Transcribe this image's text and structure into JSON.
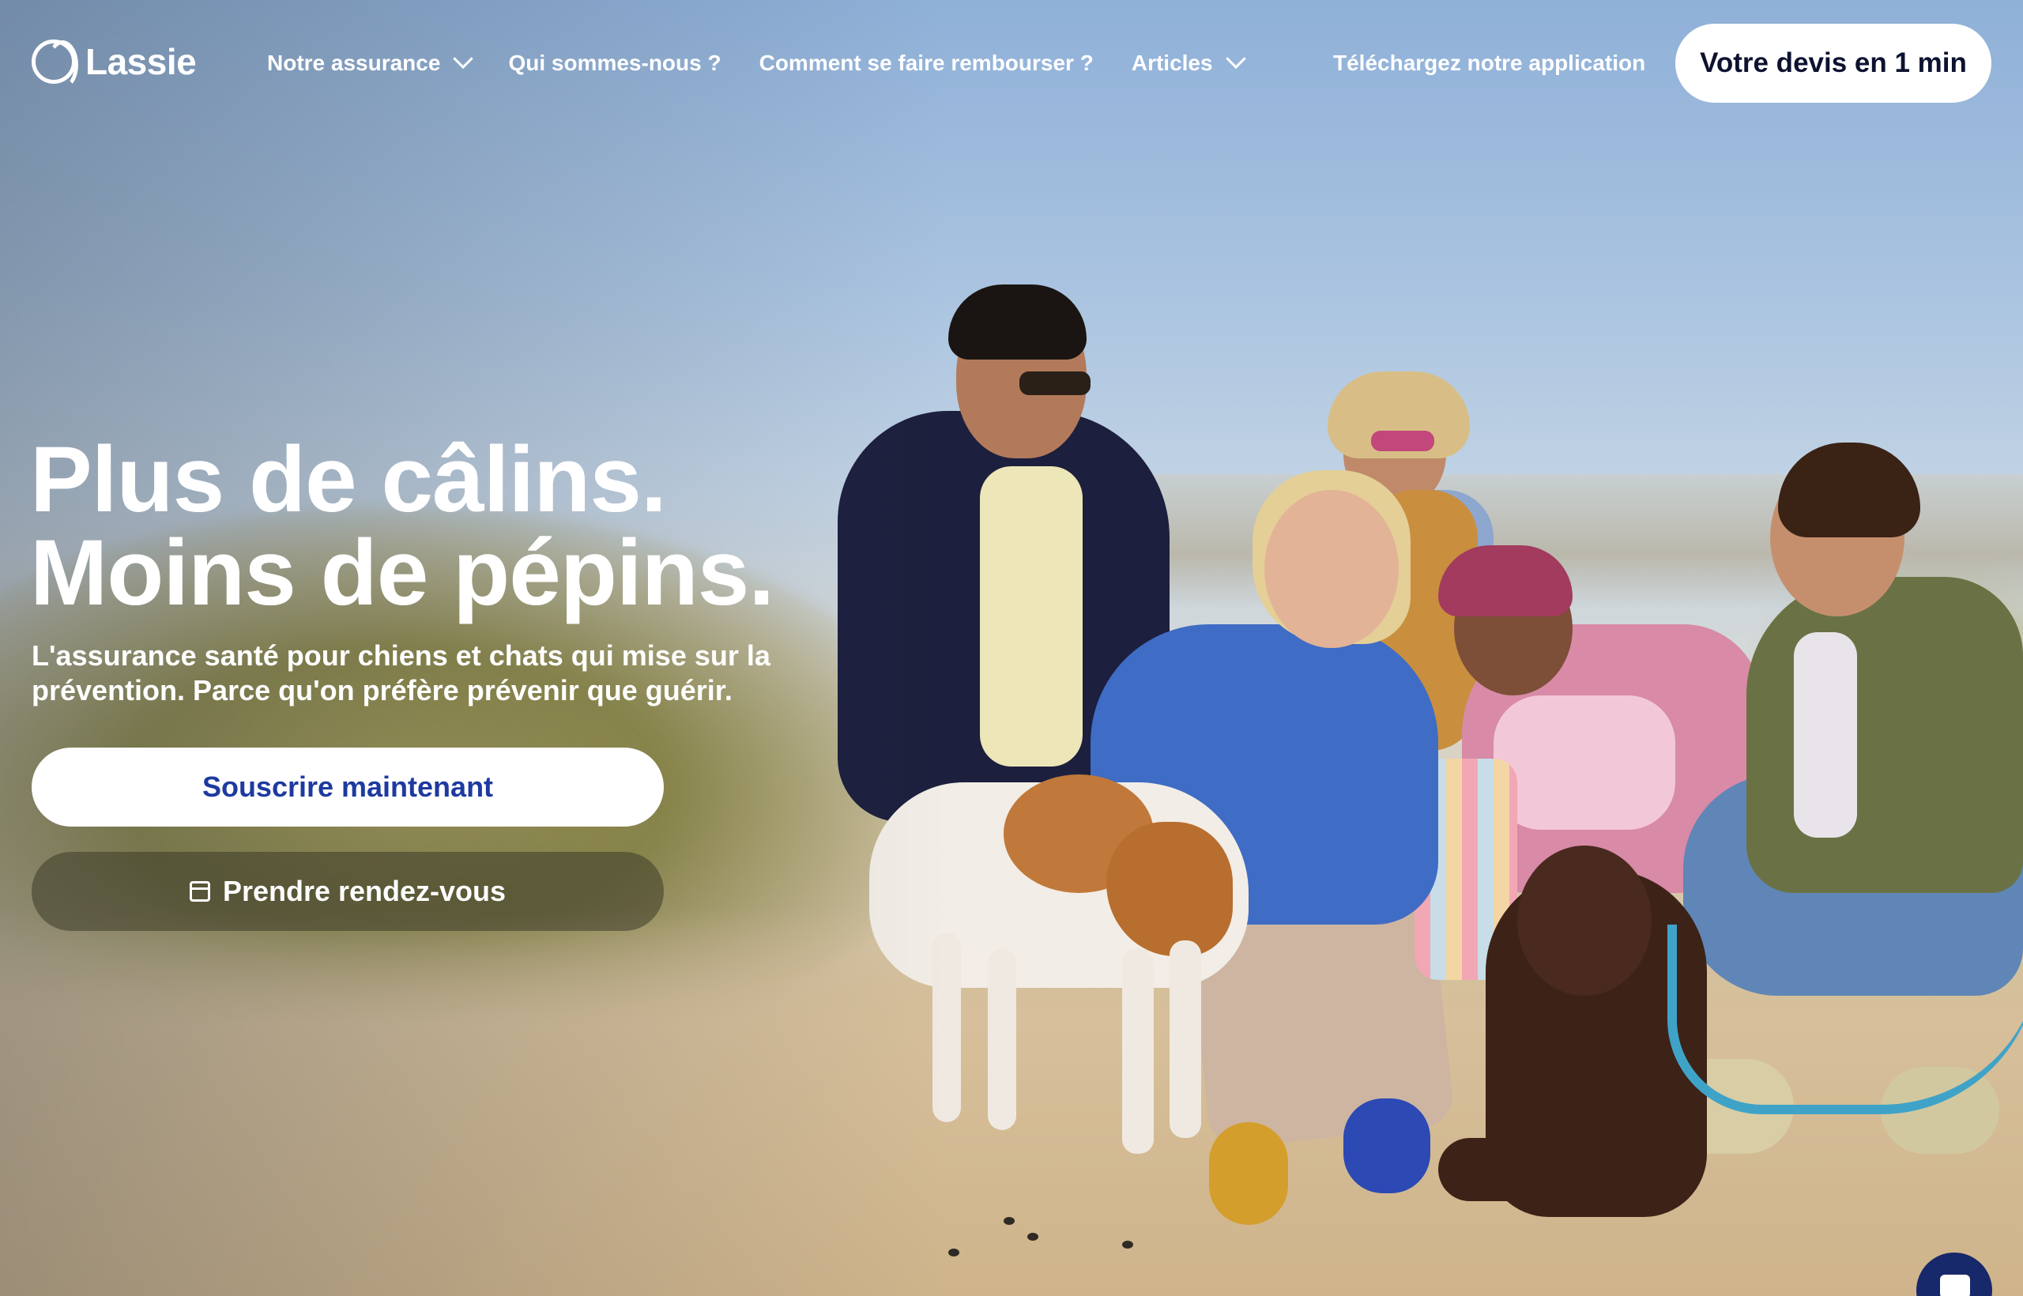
{
  "brand": {
    "name": "Lassie"
  },
  "nav": {
    "items": [
      {
        "label": "Notre assurance",
        "has_dropdown": true
      },
      {
        "label": "Qui sommes-nous ?",
        "has_dropdown": false
      },
      {
        "label": "Comment se faire rembourser ?",
        "has_dropdown": false
      },
      {
        "label": "Articles",
        "has_dropdown": true
      }
    ],
    "download_label": "Téléchargez notre application",
    "cta_label": "Votre devis en 1 min"
  },
  "hero": {
    "headline_line1": "Plus de câlins.",
    "headline_line2": "Moins de pépins.",
    "subline_line1": "L'assurance santé pour chiens et chats qui mise sur la",
    "subline_line2": "prévention. Parce qu'on préfère prévenir que guérir.",
    "primary_button": "Souscrire maintenant",
    "secondary_button": "Prendre rendez-vous"
  },
  "icons": {
    "logo": "lassie-logo-icon",
    "dropdown": "chevron-down-icon",
    "calendar": "calendar-icon",
    "chat": "chat-icon"
  },
  "colors": {
    "cta_text": "#0d1230",
    "primary_button_text": "#1e3aa0",
    "chat_bubble": "#17286b"
  }
}
